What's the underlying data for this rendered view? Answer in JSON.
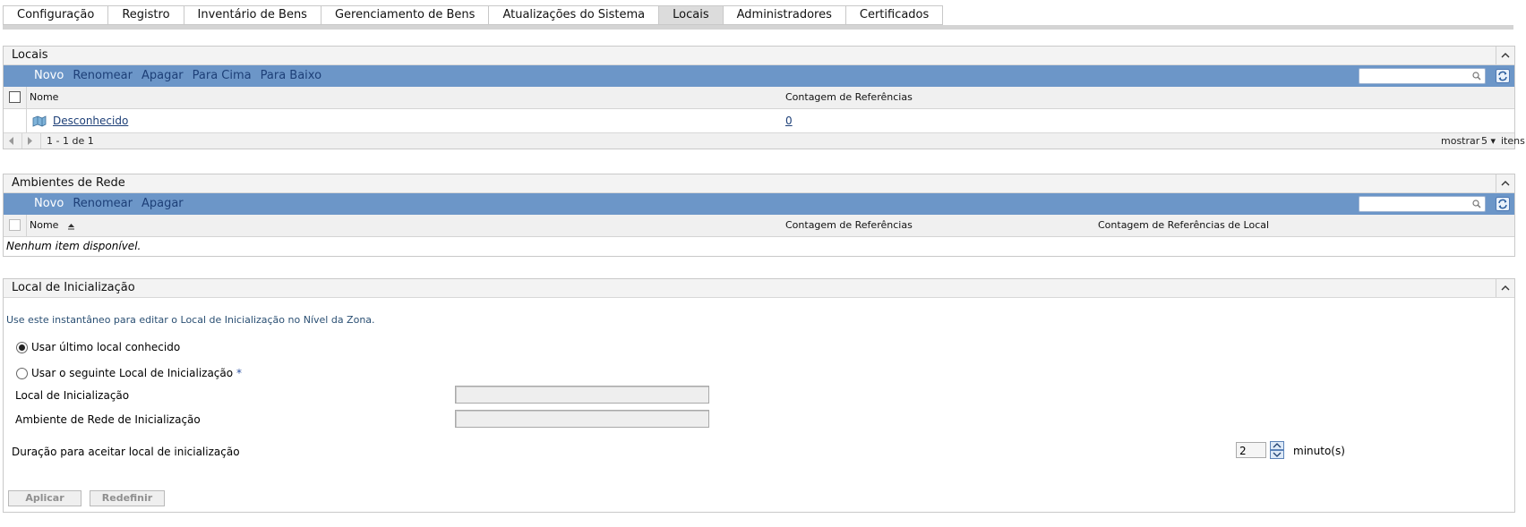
{
  "tabs": [
    {
      "label": "Configuração",
      "active": false
    },
    {
      "label": "Registro",
      "active": false
    },
    {
      "label": "Inventário de Bens",
      "active": false
    },
    {
      "label": "Gerenciamento de Bens",
      "active": false
    },
    {
      "label": "Atualizações do Sistema",
      "active": false
    },
    {
      "label": "Locais",
      "active": true
    },
    {
      "label": "Administradores",
      "active": false
    },
    {
      "label": "Certificados",
      "active": false
    }
  ],
  "locations_panel": {
    "title": "Locais",
    "toolbar": {
      "new": "Novo",
      "rename": "Renomear",
      "delete": "Apagar",
      "move_up": "Para Cima",
      "move_down": "Para Baixo"
    },
    "columns": {
      "name": "Nome",
      "ref_count": "Contagem de Referências"
    },
    "rows": [
      {
        "name": "Desconhecido",
        "ref_count": "0"
      }
    ],
    "pager": {
      "range": "1 - 1 de 1",
      "show_label": "mostrar",
      "page_size": "5",
      "items_label": "itens"
    }
  },
  "network_panel": {
    "title": "Ambientes de Rede",
    "toolbar": {
      "new": "Novo",
      "rename": "Renomear",
      "delete": "Apagar"
    },
    "columns": {
      "name": "Nome",
      "ref_count": "Contagem de Referências",
      "location_ref_count": "Contagem de Referências de Local"
    },
    "empty": "Nenhum item disponível."
  },
  "startup_panel": {
    "title": "Local de Inicialização",
    "hint": "Use este instantâneo para editar o Local de Inicialização no Nível da Zona.",
    "option_last": "Usar último local conhecido",
    "option_following": "Usar o seguinte Local de Inicialização",
    "required_mark": "*",
    "startup_location_label": "Local de Inicialização",
    "startup_network_label": "Ambiente de Rede de Inicialização",
    "duration_label": "Duração para aceitar local de inicialização",
    "duration_value": "2",
    "duration_unit": "minuto(s)",
    "apply": "Aplicar",
    "reset": "Redefinir",
    "selected_option": "last"
  },
  "colors": {
    "toolbar": "#6c96c8",
    "link": "#1d3f77",
    "active_tab": "#dcdcdc"
  },
  "icons": {
    "collapse": "chevron-up-icon",
    "search": "search-icon",
    "refresh": "refresh-icon",
    "location": "location-folder-icon",
    "sort": "sort-ascending-icon"
  }
}
